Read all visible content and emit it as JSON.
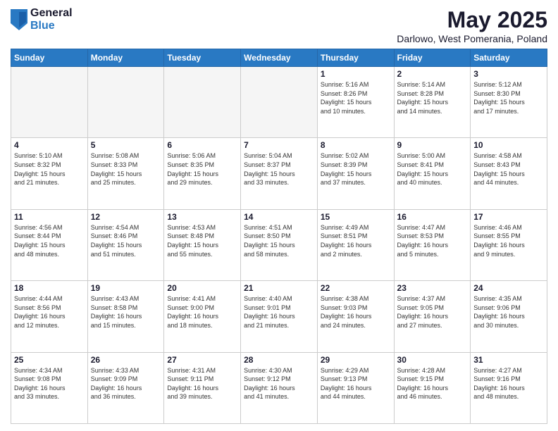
{
  "logo": {
    "general": "General",
    "blue": "Blue"
  },
  "header": {
    "title": "May 2025",
    "subtitle": "Darlowo, West Pomerania, Poland"
  },
  "weekdays": [
    "Sunday",
    "Monday",
    "Tuesday",
    "Wednesday",
    "Thursday",
    "Friday",
    "Saturday"
  ],
  "weeks": [
    [
      {
        "day": "",
        "info": ""
      },
      {
        "day": "",
        "info": ""
      },
      {
        "day": "",
        "info": ""
      },
      {
        "day": "",
        "info": ""
      },
      {
        "day": "1",
        "info": "Sunrise: 5:16 AM\nSunset: 8:26 PM\nDaylight: 15 hours\nand 10 minutes."
      },
      {
        "day": "2",
        "info": "Sunrise: 5:14 AM\nSunset: 8:28 PM\nDaylight: 15 hours\nand 14 minutes."
      },
      {
        "day": "3",
        "info": "Sunrise: 5:12 AM\nSunset: 8:30 PM\nDaylight: 15 hours\nand 17 minutes."
      }
    ],
    [
      {
        "day": "4",
        "info": "Sunrise: 5:10 AM\nSunset: 8:32 PM\nDaylight: 15 hours\nand 21 minutes."
      },
      {
        "day": "5",
        "info": "Sunrise: 5:08 AM\nSunset: 8:33 PM\nDaylight: 15 hours\nand 25 minutes."
      },
      {
        "day": "6",
        "info": "Sunrise: 5:06 AM\nSunset: 8:35 PM\nDaylight: 15 hours\nand 29 minutes."
      },
      {
        "day": "7",
        "info": "Sunrise: 5:04 AM\nSunset: 8:37 PM\nDaylight: 15 hours\nand 33 minutes."
      },
      {
        "day": "8",
        "info": "Sunrise: 5:02 AM\nSunset: 8:39 PM\nDaylight: 15 hours\nand 37 minutes."
      },
      {
        "day": "9",
        "info": "Sunrise: 5:00 AM\nSunset: 8:41 PM\nDaylight: 15 hours\nand 40 minutes."
      },
      {
        "day": "10",
        "info": "Sunrise: 4:58 AM\nSunset: 8:43 PM\nDaylight: 15 hours\nand 44 minutes."
      }
    ],
    [
      {
        "day": "11",
        "info": "Sunrise: 4:56 AM\nSunset: 8:44 PM\nDaylight: 15 hours\nand 48 minutes."
      },
      {
        "day": "12",
        "info": "Sunrise: 4:54 AM\nSunset: 8:46 PM\nDaylight: 15 hours\nand 51 minutes."
      },
      {
        "day": "13",
        "info": "Sunrise: 4:53 AM\nSunset: 8:48 PM\nDaylight: 15 hours\nand 55 minutes."
      },
      {
        "day": "14",
        "info": "Sunrise: 4:51 AM\nSunset: 8:50 PM\nDaylight: 15 hours\nand 58 minutes."
      },
      {
        "day": "15",
        "info": "Sunrise: 4:49 AM\nSunset: 8:51 PM\nDaylight: 16 hours\nand 2 minutes."
      },
      {
        "day": "16",
        "info": "Sunrise: 4:47 AM\nSunset: 8:53 PM\nDaylight: 16 hours\nand 5 minutes."
      },
      {
        "day": "17",
        "info": "Sunrise: 4:46 AM\nSunset: 8:55 PM\nDaylight: 16 hours\nand 9 minutes."
      }
    ],
    [
      {
        "day": "18",
        "info": "Sunrise: 4:44 AM\nSunset: 8:56 PM\nDaylight: 16 hours\nand 12 minutes."
      },
      {
        "day": "19",
        "info": "Sunrise: 4:43 AM\nSunset: 8:58 PM\nDaylight: 16 hours\nand 15 minutes."
      },
      {
        "day": "20",
        "info": "Sunrise: 4:41 AM\nSunset: 9:00 PM\nDaylight: 16 hours\nand 18 minutes."
      },
      {
        "day": "21",
        "info": "Sunrise: 4:40 AM\nSunset: 9:01 PM\nDaylight: 16 hours\nand 21 minutes."
      },
      {
        "day": "22",
        "info": "Sunrise: 4:38 AM\nSunset: 9:03 PM\nDaylight: 16 hours\nand 24 minutes."
      },
      {
        "day": "23",
        "info": "Sunrise: 4:37 AM\nSunset: 9:05 PM\nDaylight: 16 hours\nand 27 minutes."
      },
      {
        "day": "24",
        "info": "Sunrise: 4:35 AM\nSunset: 9:06 PM\nDaylight: 16 hours\nand 30 minutes."
      }
    ],
    [
      {
        "day": "25",
        "info": "Sunrise: 4:34 AM\nSunset: 9:08 PM\nDaylight: 16 hours\nand 33 minutes."
      },
      {
        "day": "26",
        "info": "Sunrise: 4:33 AM\nSunset: 9:09 PM\nDaylight: 16 hours\nand 36 minutes."
      },
      {
        "day": "27",
        "info": "Sunrise: 4:31 AM\nSunset: 9:11 PM\nDaylight: 16 hours\nand 39 minutes."
      },
      {
        "day": "28",
        "info": "Sunrise: 4:30 AM\nSunset: 9:12 PM\nDaylight: 16 hours\nand 41 minutes."
      },
      {
        "day": "29",
        "info": "Sunrise: 4:29 AM\nSunset: 9:13 PM\nDaylight: 16 hours\nand 44 minutes."
      },
      {
        "day": "30",
        "info": "Sunrise: 4:28 AM\nSunset: 9:15 PM\nDaylight: 16 hours\nand 46 minutes."
      },
      {
        "day": "31",
        "info": "Sunrise: 4:27 AM\nSunset: 9:16 PM\nDaylight: 16 hours\nand 48 minutes."
      }
    ]
  ]
}
